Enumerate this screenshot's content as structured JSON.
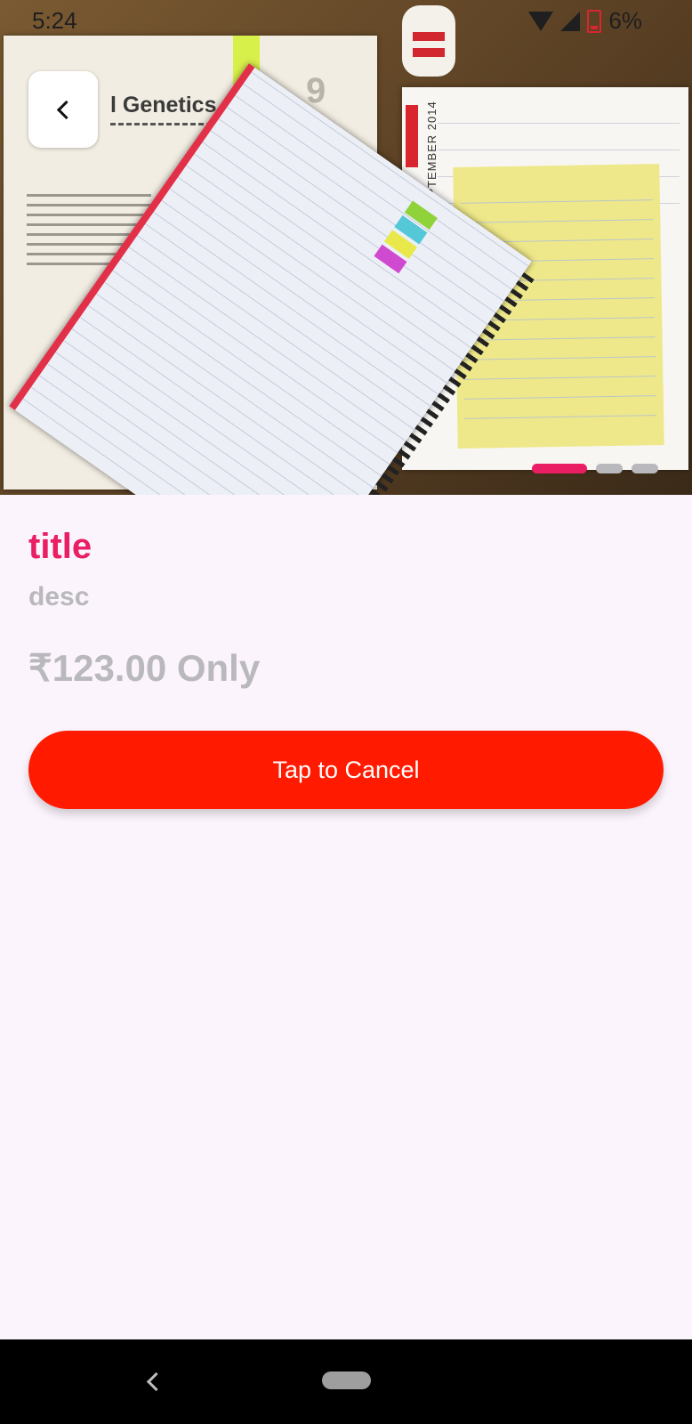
{
  "status_bar": {
    "time": "5:24",
    "battery": "6%"
  },
  "hero": {
    "book_heading": "l Genetics",
    "chapter_number": "9",
    "planner_month": "SEPTEMBER 2014",
    "carousel": {
      "count": 3,
      "active_index": 0
    }
  },
  "product": {
    "title": "title",
    "desc": "desc",
    "price": "₹123.00 Only"
  },
  "actions": {
    "cancel_label": "Tap to Cancel"
  },
  "colors": {
    "accent": "#e91e63",
    "cancel_button": "#ff1a00",
    "page_background": "#fcf4fc",
    "muted_text": "#b9b8bc"
  },
  "icons": {
    "back": "chevron-left-icon",
    "wifi": "wifi-icon",
    "cell": "cell-signal-icon",
    "battery": "battery-low-icon",
    "nav_back": "nav-back-icon",
    "nav_home": "nav-home-pill"
  }
}
